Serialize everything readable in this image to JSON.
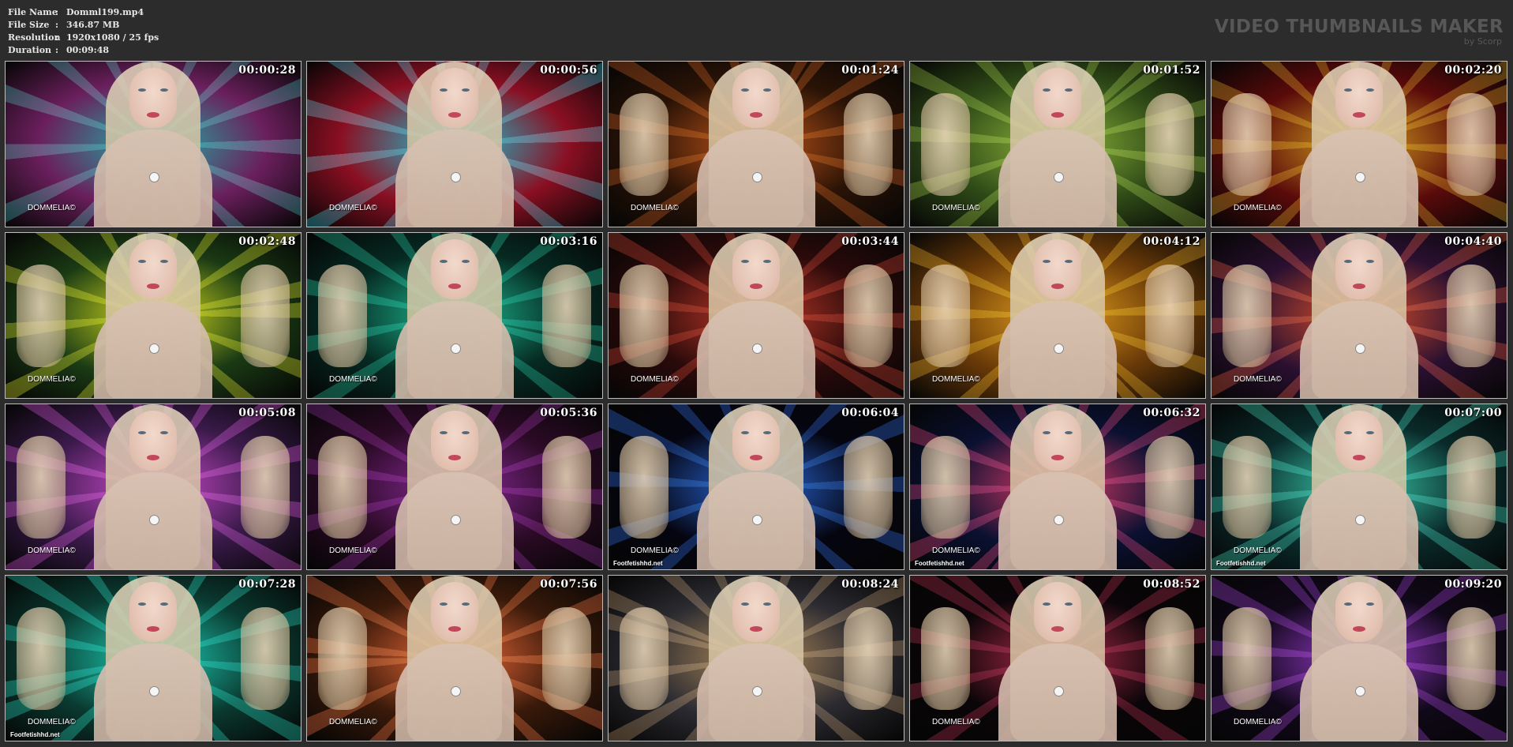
{
  "header": {
    "file_name_label": "File Name",
    "file_name_value": "Domml199.mp4",
    "file_size_label": "File Size",
    "file_size_value": "346.87 MB",
    "resolution_label": "Resolution",
    "resolution_value": "1920x1080 / 25 fps",
    "duration_label": "Duration",
    "duration_value": "00:09:48",
    "separator": ":"
  },
  "brand": {
    "title": "VIDEO THUMBNAILS MAKER",
    "subtitle": "by Scorp"
  },
  "thumbnails": [
    {
      "time": "00:00:28",
      "watermark": "DOMMELIA©",
      "site": "",
      "bg": "#6a1f5c",
      "accent": "#1fb3a8",
      "feet": false
    },
    {
      "time": "00:00:56",
      "watermark": "DOMMELIA©",
      "site": "",
      "bg": "#8a0f22",
      "accent": "#19c6d8",
      "feet": false
    },
    {
      "time": "00:01:24",
      "watermark": "DOMMELIA©",
      "site": "",
      "bg": "#2a1306",
      "accent": "#c2551a",
      "feet": true
    },
    {
      "time": "00:01:52",
      "watermark": "DOMMELIA©",
      "site": "",
      "bg": "#2f4a17",
      "accent": "#8fb63a",
      "feet": true
    },
    {
      "time": "00:02:20",
      "watermark": "DOMMELIA©",
      "site": "",
      "bg": "#5a0a0a",
      "accent": "#d6a21e",
      "feet": true
    },
    {
      "time": "00:02:48",
      "watermark": "DOMMELIA©",
      "site": "",
      "bg": "#1a3a14",
      "accent": "#d8e01e",
      "feet": true
    },
    {
      "time": "00:03:16",
      "watermark": "DOMMELIA©",
      "site": "",
      "bg": "#062a22",
      "accent": "#1ebf96",
      "feet": true
    },
    {
      "time": "00:03:44",
      "watermark": "DOMMELIA©",
      "site": "",
      "bg": "#2a0a0a",
      "accent": "#c43a2a",
      "feet": true
    },
    {
      "time": "00:04:12",
      "watermark": "DOMMELIA©",
      "site": "",
      "bg": "#6a3a08",
      "accent": "#e8a21e",
      "feet": true
    },
    {
      "time": "00:04:40",
      "watermark": "DOMMELIA©",
      "site": "",
      "bg": "#2a1030",
      "accent": "#e0502a",
      "feet": true
    },
    {
      "time": "00:05:08",
      "watermark": "DOMMELIA©",
      "site": "",
      "bg": "#3a1a4a",
      "accent": "#d04ad0",
      "feet": true
    },
    {
      "time": "00:05:36",
      "watermark": "DOMMELIA©",
      "site": "",
      "bg": "#2a0a24",
      "accent": "#8a2a9a",
      "feet": true
    },
    {
      "time": "00:06:04",
      "watermark": "DOMMELIA©",
      "site": "Footfetishhd.net",
      "bg": "#050510",
      "accent": "#2a6ae0",
      "feet": true
    },
    {
      "time": "00:06:32",
      "watermark": "DOMMELIA©",
      "site": "Footfetishhd.net",
      "bg": "#0a1030",
      "accent": "#e03a6a",
      "feet": true
    },
    {
      "time": "00:07:00",
      "watermark": "DOMMELIA©",
      "site": "Footfetishhd.net",
      "bg": "#0a2a2a",
      "accent": "#3ad0b0",
      "feet": true
    },
    {
      "time": "00:07:28",
      "watermark": "DOMMELIA©",
      "site": "Footfetishhd.net",
      "bg": "#0a3a30",
      "accent": "#1ed0b8",
      "feet": true
    },
    {
      "time": "00:07:56",
      "watermark": "DOMMELIA©",
      "site": "",
      "bg": "#3a1a0a",
      "accent": "#f06a3a",
      "feet": true
    },
    {
      "time": "00:08:24",
      "watermark": "",
      "site": "",
      "bg": "#2a2a30",
      "accent": "#b08a5a",
      "feet": true
    },
    {
      "time": "00:08:52",
      "watermark": "DOMMELIA©",
      "site": "",
      "bg": "#0a0508",
      "accent": "#b02a4a",
      "feet": true
    },
    {
      "time": "00:09:20",
      "watermark": "DOMMELIA©",
      "site": "",
      "bg": "#100818",
      "accent": "#9a3ad0",
      "feet": true
    }
  ]
}
